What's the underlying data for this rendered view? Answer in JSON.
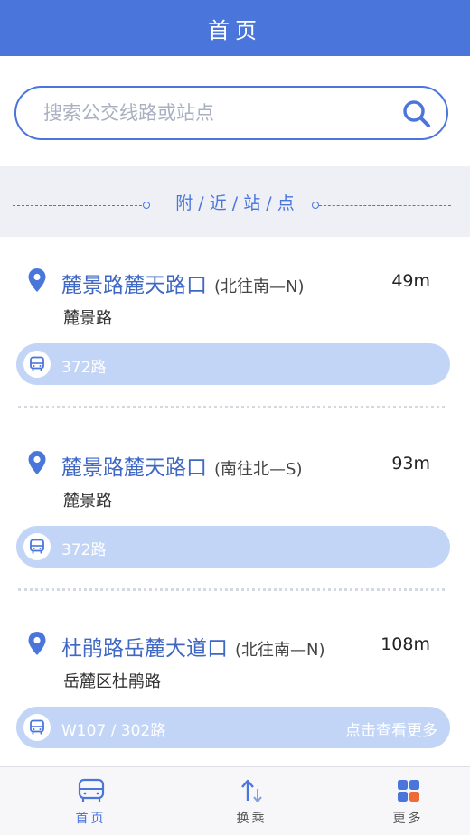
{
  "header": {
    "title": "首页"
  },
  "search": {
    "placeholder": "搜索公交线路或站点",
    "value": ""
  },
  "section": {
    "title": "附 / 近 / 站 / 点"
  },
  "stops": [
    {
      "name": "麓景路麓天路口",
      "direction": "(北往南—N)",
      "distance": "49m",
      "road": "麓景路",
      "routes": "372路",
      "more": ""
    },
    {
      "name": "麓景路麓天路口",
      "direction": "(南往北—S)",
      "distance": "93m",
      "road": "麓景路",
      "routes": "372路",
      "more": ""
    },
    {
      "name": "杜鹃路岳麓大道口",
      "direction": "(北往南—N)",
      "distance": "108m",
      "road": "岳麓区杜鹃路",
      "routes": "W107 / 302路",
      "more": "点击查看更多"
    }
  ],
  "tabbar": {
    "tabs": [
      {
        "label": "首页",
        "icon": "bus-icon",
        "active": true
      },
      {
        "label": "换乘",
        "icon": "transfer-icon",
        "active": false
      },
      {
        "label": "更多",
        "icon": "grid-icon",
        "active": false
      }
    ]
  },
  "colors": {
    "primary": "#4a76dc",
    "route_bar": "#c3d5f7",
    "orange": "#f06a35",
    "band": "#eef0f5"
  }
}
